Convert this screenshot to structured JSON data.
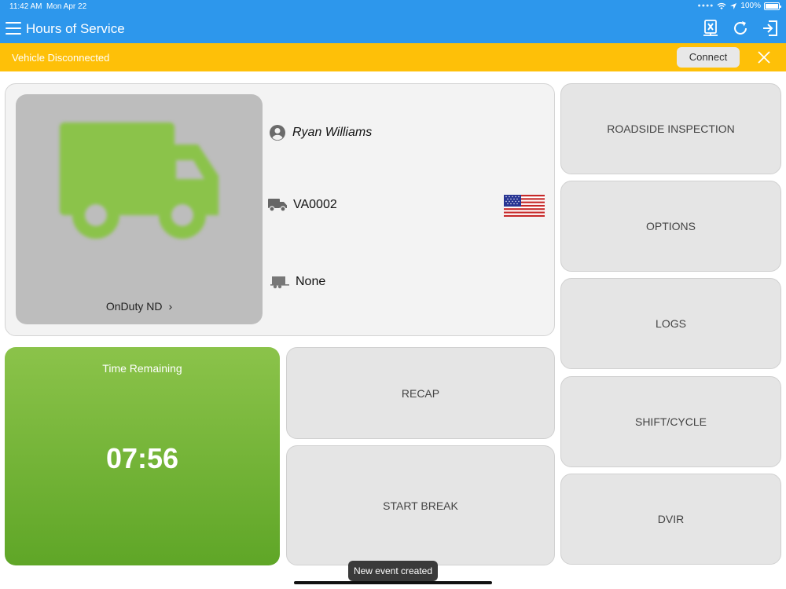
{
  "status_bar": {
    "time": "11:42 AM",
    "date": "Mon Apr 22",
    "battery": "100%"
  },
  "header": {
    "title": "Hours of Service",
    "icons": [
      "menu-icon",
      "disconnect-device-icon",
      "refresh-icon",
      "logout-icon"
    ]
  },
  "alert": {
    "message": "Vehicle Disconnected",
    "connect_label": "Connect"
  },
  "info": {
    "duty_status": "OnDuty ND",
    "driver_name": "Ryan Williams",
    "vehicle_id": "VA0002",
    "trailer": "None",
    "country_flag": "us-flag"
  },
  "time_remaining": {
    "label": "Time Remaining",
    "value": "07:56"
  },
  "buttons": {
    "recap": "RECAP",
    "start_break": "START BREAK",
    "roadside_inspection": "ROADSIDE INSPECTION",
    "options": "OPTIONS",
    "logs": "LOGS",
    "shift_cycle": "SHIFT/CYCLE",
    "dvir": "DVIR"
  },
  "toast": "New event created",
  "colors": {
    "header": "#2d97ec",
    "alert": "#fec008",
    "time_tile": "#7cb342",
    "truck": "#8bc34a"
  }
}
